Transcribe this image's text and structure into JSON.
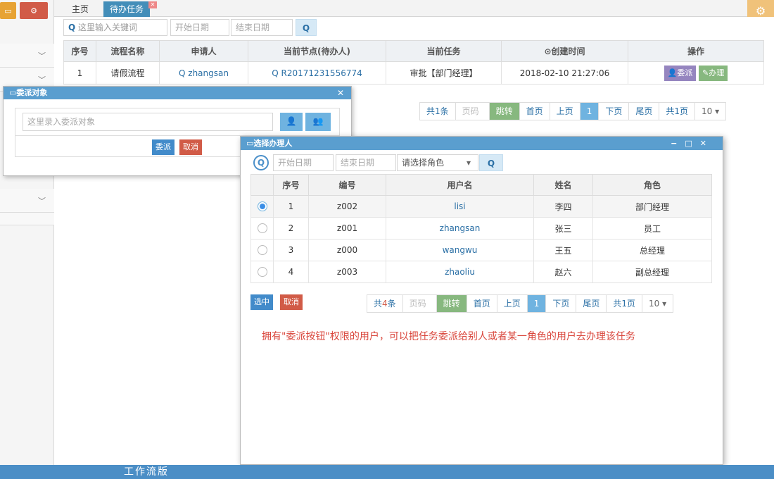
{
  "sidebar": {
    "btn1_icon": "monitor-icon",
    "btn2_icon": "gear-icon"
  },
  "tabs": {
    "home": "主页",
    "active": "待办任务"
  },
  "search": {
    "keyword_placeholder": "这里输入关键词",
    "start_date": "开始日期",
    "end_date": "结束日期"
  },
  "task_table": {
    "headers": [
      "序号",
      "流程名称",
      "申请人",
      "当前节点(待办人)",
      "当前任务",
      "创建时间",
      "操作"
    ],
    "rows": [
      {
        "no": "1",
        "process": "请假流程",
        "applicant": "zhangsan",
        "node": "R20171231556774",
        "task": "审批【部门经理】",
        "created": "2018-02-10 21:27:06",
        "delegate": "委派",
        "handle": "办理"
      }
    ]
  },
  "pager_main": {
    "total": "共1条",
    "page_input": "页码",
    "jump": "跳转",
    "first": "首页",
    "prev": "上页",
    "current": "1",
    "next": "下页",
    "last": "尾页",
    "pages": "共1页",
    "size": "10"
  },
  "delegate_dialog": {
    "title": "委派对象",
    "placeholder": "这里录入委派对象",
    "confirm": "委派",
    "cancel": "取消"
  },
  "select_dialog": {
    "title": "选择办理人",
    "start_date": "开始日期",
    "end_date": "结束日期",
    "role_select": "请选择角色",
    "headers": [
      "",
      "序号",
      "编号",
      "用户名",
      "姓名",
      "角色"
    ],
    "rows": [
      {
        "no": "1",
        "code": "z002",
        "username": "lisi",
        "name": "李四",
        "role": "部门经理",
        "selected": true
      },
      {
        "no": "2",
        "code": "z001",
        "username": "zhangsan",
        "name": "张三",
        "role": "员工",
        "selected": false
      },
      {
        "no": "3",
        "code": "z000",
        "username": "wangwu",
        "name": "王五",
        "role": "总经理",
        "selected": false
      },
      {
        "no": "4",
        "code": "z003",
        "username": "zhaoliu",
        "name": "赵六",
        "role": "副总经理",
        "selected": false
      }
    ],
    "select_btn": "选中",
    "cancel_btn": "取消",
    "pager": {
      "total_prefix": "共",
      "total_count": "4",
      "total_suffix": "条",
      "page_input": "页码",
      "jump": "跳转",
      "first": "首页",
      "prev": "上页",
      "current": "1",
      "next": "下页",
      "last": "尾页",
      "pages": "共1页",
      "size": "10"
    },
    "note": "拥有\"委派按钮\"权限的用户，可以把任务委派给别人或者某一角色的用户去办理该任务"
  },
  "footer": {
    "text": "工作流版"
  }
}
